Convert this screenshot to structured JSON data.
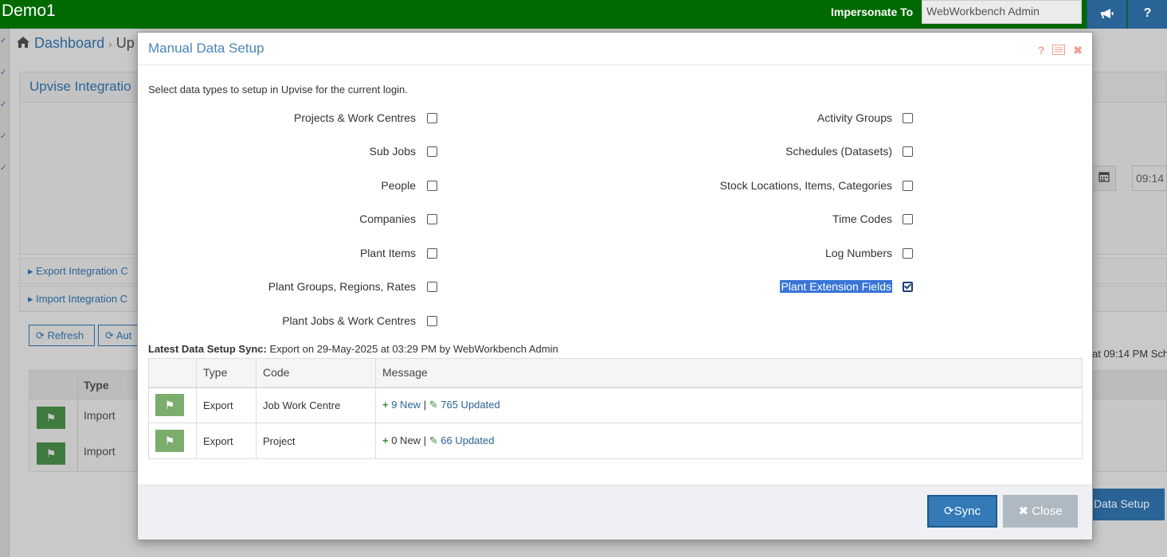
{
  "topbar": {
    "app_title": "Demo1",
    "impersonate_label": "Impersonate To",
    "impersonate_value": "WebWorkbench Admin",
    "announce_icon": "megaphone-icon",
    "help_label": "?"
  },
  "background": {
    "breadcrumb_home": "Dashboard",
    "breadcrumb_sep": "›",
    "breadcrumb_current": "Up",
    "panel_title": "Upvise Integratio",
    "export_section": "Export Integration C",
    "import_section": "Import Integration C",
    "refresh_label": "Refresh",
    "auto_label": "Aut",
    "table_type_header": "Type",
    "rows": [
      "Import",
      "Import"
    ],
    "time_value": "09:14",
    "schedule_text": "at 09:14 PM Sch",
    "data_setup_label": "Data Setup"
  },
  "modal": {
    "title": "Manual Data Setup",
    "help_icon": "question-icon",
    "intro": "Select data types to setup in Upvise for the current login.",
    "left_options": [
      {
        "label": "Projects & Work Centres",
        "checked": false
      },
      {
        "label": "Sub Jobs",
        "checked": false
      },
      {
        "label": "People",
        "checked": false
      },
      {
        "label": "Companies",
        "checked": false
      },
      {
        "label": "Plant Items",
        "checked": false
      },
      {
        "label": "Plant Groups, Regions, Rates",
        "checked": false
      },
      {
        "label": "Plant Jobs & Work Centres",
        "checked": false
      }
    ],
    "right_options": [
      {
        "label": "Activity Groups",
        "checked": false
      },
      {
        "label": "Schedules (Datasets)",
        "checked": false
      },
      {
        "label": "Stock Locations, Items, Categories",
        "checked": false
      },
      {
        "label": "Time Codes",
        "checked": false
      },
      {
        "label": "Log Numbers",
        "checked": false
      },
      {
        "label": "Plant Extension Fields",
        "checked": true
      }
    ],
    "sync_label": "Latest Data Setup Sync:",
    "sync_text": "Export on 29-May-2025 at 03:29 PM by WebWorkbench Admin",
    "table": {
      "headers": [
        "",
        "Type",
        "Code",
        "Message"
      ],
      "rows": [
        {
          "type": "Export",
          "code": "Job Work Centre",
          "new": "9 New",
          "sep": "|",
          "updated": "765 Updated"
        },
        {
          "type": "Export",
          "code": "Project",
          "new": "0 New",
          "sep": "|",
          "updated": "66 Updated"
        }
      ]
    },
    "sync_button": "Sync",
    "close_button": "Close"
  }
}
